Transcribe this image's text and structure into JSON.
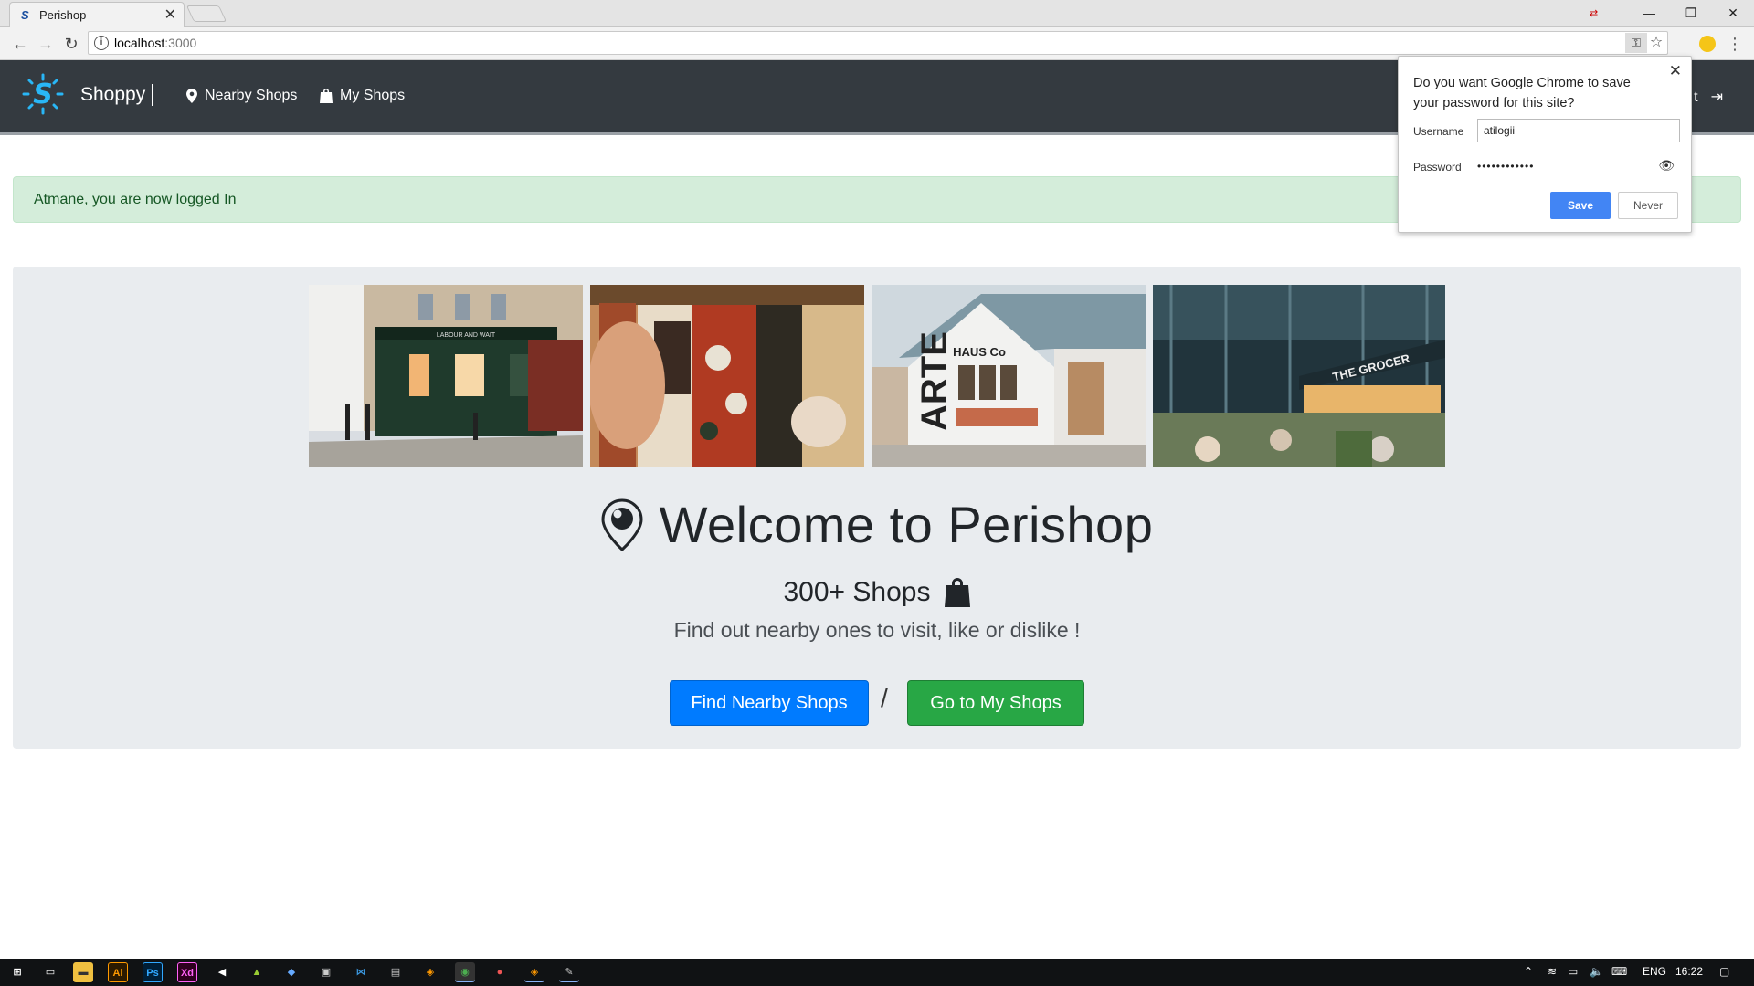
{
  "browser": {
    "tab_title": "Perishop",
    "tab_close": "✕",
    "url_host": "localhost",
    "url_port": ":3000",
    "window_controls": [
      "—",
      "❐",
      "✕"
    ]
  },
  "navbar": {
    "brand": "Shoppy",
    "links": [
      {
        "label": "Nearby Shops",
        "icon": "map-marker-icon"
      },
      {
        "label": "My Shops",
        "icon": "shopping-bag-icon"
      }
    ],
    "right_partial_text": "t"
  },
  "alert": {
    "message": "Atmane, you are now logged In"
  },
  "hero": {
    "photos": [
      {
        "label": "LABOUR AND WAIT"
      },
      {
        "label": ""
      },
      {
        "label": "HAUS Co"
      },
      {
        "label": "THE GROCER"
      }
    ],
    "title": "Welcome to Perishop",
    "count_text": "300+ Shops",
    "lead": "Find out nearby ones to visit, like or dislike !",
    "primary_button": "Find Nearby Shops",
    "separator": "/",
    "secondary_button": "Go to My Shops"
  },
  "password_prompt": {
    "question": "Do you want Google Chrome to save your password for this site?",
    "username_label": "Username",
    "username_value": "atilogii",
    "password_label": "Password",
    "password_value": "••••••••••••",
    "save_label": "Save",
    "never_label": "Never"
  },
  "taskbar": {
    "language": "ENG",
    "time": "16:22"
  },
  "colors": {
    "navbar_bg": "#343a40",
    "alert_bg": "#d4edda",
    "primary": "#007bff",
    "success": "#28a745",
    "jumbotron_bg": "#e9ecef"
  }
}
